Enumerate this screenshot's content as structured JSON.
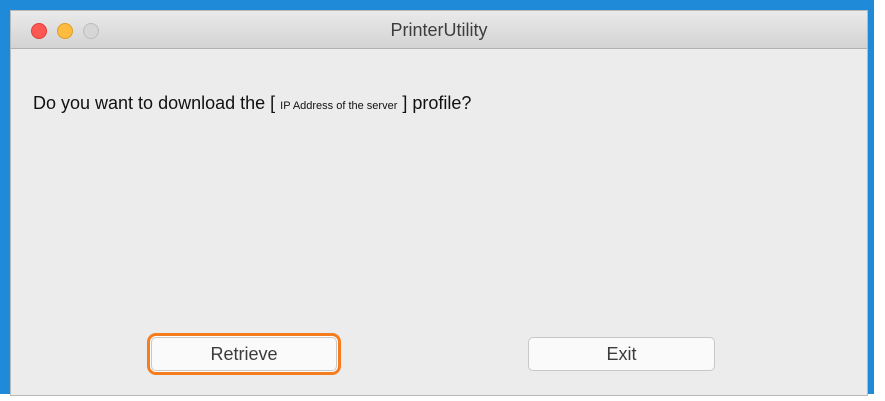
{
  "window": {
    "title": "PrinterUtility"
  },
  "dialog": {
    "message_before": "Do you want to download the [ ",
    "message_placeholder": "IP Address of the server",
    "message_after": " ] profile?"
  },
  "buttons": {
    "retrieve_label": "Retrieve",
    "exit_label": "Exit"
  },
  "colors": {
    "accent_highlight": "#f57c1f",
    "frame_blue": "#1f8ad8",
    "close": "#fc5753",
    "minimize": "#fdbc40",
    "zoom_disabled": "#d6d6d6"
  }
}
